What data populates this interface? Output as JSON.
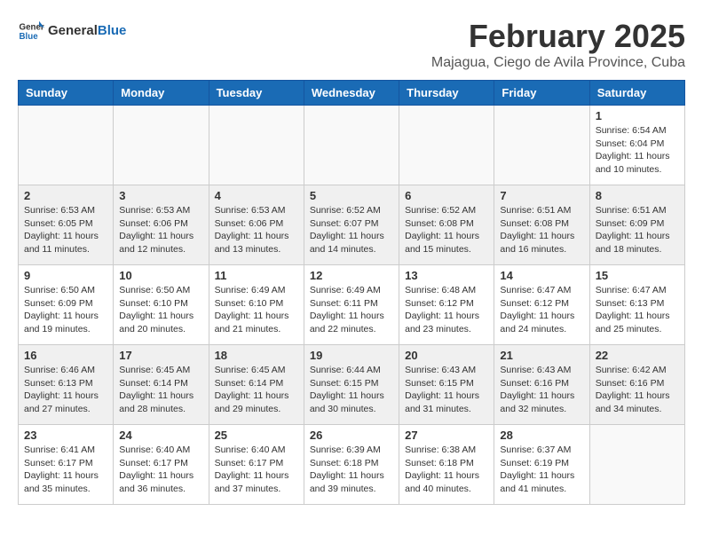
{
  "header": {
    "logo_general": "General",
    "logo_blue": "Blue",
    "month_title": "February 2025",
    "location": "Majagua, Ciego de Avila Province, Cuba"
  },
  "weekdays": [
    "Sunday",
    "Monday",
    "Tuesday",
    "Wednesday",
    "Thursday",
    "Friday",
    "Saturday"
  ],
  "weeks": [
    [
      {
        "day": "",
        "info": ""
      },
      {
        "day": "",
        "info": ""
      },
      {
        "day": "",
        "info": ""
      },
      {
        "day": "",
        "info": ""
      },
      {
        "day": "",
        "info": ""
      },
      {
        "day": "",
        "info": ""
      },
      {
        "day": "1",
        "info": "Sunrise: 6:54 AM\nSunset: 6:04 PM\nDaylight: 11 hours\nand 10 minutes."
      }
    ],
    [
      {
        "day": "2",
        "info": "Sunrise: 6:53 AM\nSunset: 6:05 PM\nDaylight: 11 hours\nand 11 minutes."
      },
      {
        "day": "3",
        "info": "Sunrise: 6:53 AM\nSunset: 6:06 PM\nDaylight: 11 hours\nand 12 minutes."
      },
      {
        "day": "4",
        "info": "Sunrise: 6:53 AM\nSunset: 6:06 PM\nDaylight: 11 hours\nand 13 minutes."
      },
      {
        "day": "5",
        "info": "Sunrise: 6:52 AM\nSunset: 6:07 PM\nDaylight: 11 hours\nand 14 minutes."
      },
      {
        "day": "6",
        "info": "Sunrise: 6:52 AM\nSunset: 6:08 PM\nDaylight: 11 hours\nand 15 minutes."
      },
      {
        "day": "7",
        "info": "Sunrise: 6:51 AM\nSunset: 6:08 PM\nDaylight: 11 hours\nand 16 minutes."
      },
      {
        "day": "8",
        "info": "Sunrise: 6:51 AM\nSunset: 6:09 PM\nDaylight: 11 hours\nand 18 minutes."
      }
    ],
    [
      {
        "day": "9",
        "info": "Sunrise: 6:50 AM\nSunset: 6:09 PM\nDaylight: 11 hours\nand 19 minutes."
      },
      {
        "day": "10",
        "info": "Sunrise: 6:50 AM\nSunset: 6:10 PM\nDaylight: 11 hours\nand 20 minutes."
      },
      {
        "day": "11",
        "info": "Sunrise: 6:49 AM\nSunset: 6:10 PM\nDaylight: 11 hours\nand 21 minutes."
      },
      {
        "day": "12",
        "info": "Sunrise: 6:49 AM\nSunset: 6:11 PM\nDaylight: 11 hours\nand 22 minutes."
      },
      {
        "day": "13",
        "info": "Sunrise: 6:48 AM\nSunset: 6:12 PM\nDaylight: 11 hours\nand 23 minutes."
      },
      {
        "day": "14",
        "info": "Sunrise: 6:47 AM\nSunset: 6:12 PM\nDaylight: 11 hours\nand 24 minutes."
      },
      {
        "day": "15",
        "info": "Sunrise: 6:47 AM\nSunset: 6:13 PM\nDaylight: 11 hours\nand 25 minutes."
      }
    ],
    [
      {
        "day": "16",
        "info": "Sunrise: 6:46 AM\nSunset: 6:13 PM\nDaylight: 11 hours\nand 27 minutes."
      },
      {
        "day": "17",
        "info": "Sunrise: 6:45 AM\nSunset: 6:14 PM\nDaylight: 11 hours\nand 28 minutes."
      },
      {
        "day": "18",
        "info": "Sunrise: 6:45 AM\nSunset: 6:14 PM\nDaylight: 11 hours\nand 29 minutes."
      },
      {
        "day": "19",
        "info": "Sunrise: 6:44 AM\nSunset: 6:15 PM\nDaylight: 11 hours\nand 30 minutes."
      },
      {
        "day": "20",
        "info": "Sunrise: 6:43 AM\nSunset: 6:15 PM\nDaylight: 11 hours\nand 31 minutes."
      },
      {
        "day": "21",
        "info": "Sunrise: 6:43 AM\nSunset: 6:16 PM\nDaylight: 11 hours\nand 32 minutes."
      },
      {
        "day": "22",
        "info": "Sunrise: 6:42 AM\nSunset: 6:16 PM\nDaylight: 11 hours\nand 34 minutes."
      }
    ],
    [
      {
        "day": "23",
        "info": "Sunrise: 6:41 AM\nSunset: 6:17 PM\nDaylight: 11 hours\nand 35 minutes."
      },
      {
        "day": "24",
        "info": "Sunrise: 6:40 AM\nSunset: 6:17 PM\nDaylight: 11 hours\nand 36 minutes."
      },
      {
        "day": "25",
        "info": "Sunrise: 6:40 AM\nSunset: 6:17 PM\nDaylight: 11 hours\nand 37 minutes."
      },
      {
        "day": "26",
        "info": "Sunrise: 6:39 AM\nSunset: 6:18 PM\nDaylight: 11 hours\nand 39 minutes."
      },
      {
        "day": "27",
        "info": "Sunrise: 6:38 AM\nSunset: 6:18 PM\nDaylight: 11 hours\nand 40 minutes."
      },
      {
        "day": "28",
        "info": "Sunrise: 6:37 AM\nSunset: 6:19 PM\nDaylight: 11 hours\nand 41 minutes."
      },
      {
        "day": "",
        "info": ""
      }
    ]
  ]
}
